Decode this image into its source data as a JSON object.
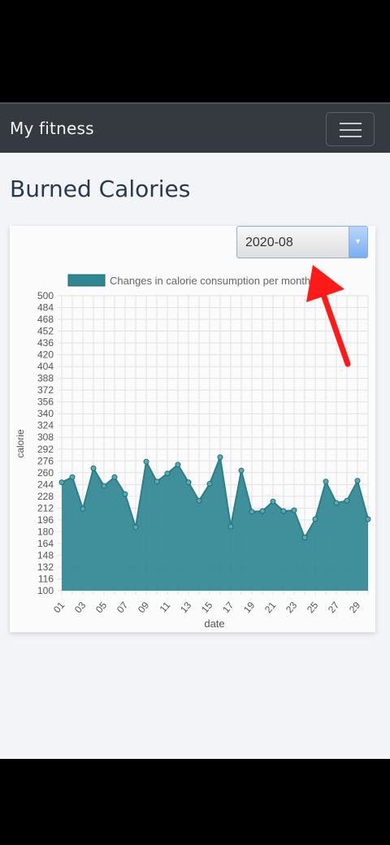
{
  "app": {
    "brand": "My fitness",
    "menu_icon": "hamburger-menu-icon"
  },
  "page": {
    "title": "Burned Calories"
  },
  "filter": {
    "selected_month": "2020-08"
  },
  "annotation": {
    "pointer": "red-arrow-icon"
  },
  "colors": {
    "navbar": "#343a40",
    "fill": "#2f8791",
    "line": "#2a7f89",
    "arrow": "#ff1a1a"
  },
  "chart_data": {
    "type": "area",
    "legend": "Changes in calorie consumption per month",
    "legend_position": "top",
    "xlabel": "date",
    "ylabel": "calorie",
    "ylim": [
      100,
      500
    ],
    "y_ticks": [
      100,
      116,
      132,
      148,
      164,
      180,
      196,
      212,
      228,
      244,
      260,
      276,
      292,
      308,
      324,
      340,
      356,
      372,
      388,
      404,
      420,
      436,
      452,
      468,
      484,
      500
    ],
    "x": [
      "01",
      "02",
      "03",
      "04",
      "05",
      "06",
      "07",
      "08",
      "09",
      "10",
      "11",
      "12",
      "13",
      "14",
      "15",
      "16",
      "17",
      "18",
      "19",
      "20",
      "21",
      "22",
      "23",
      "24",
      "25",
      "26",
      "27",
      "28",
      "29",
      "30"
    ],
    "x_tick_labels": [
      "01",
      "03",
      "05",
      "07",
      "09",
      "11",
      "13",
      "15",
      "17",
      "19",
      "21",
      "23",
      "25",
      "27",
      "29"
    ],
    "values": [
      247,
      254,
      211,
      266,
      242,
      254,
      231,
      186,
      275,
      248,
      259,
      271,
      247,
      222,
      245,
      281,
      187,
      263,
      207,
      208,
      221,
      208,
      209,
      172,
      197,
      248,
      219,
      222,
      249,
      197
    ],
    "grid": true
  }
}
